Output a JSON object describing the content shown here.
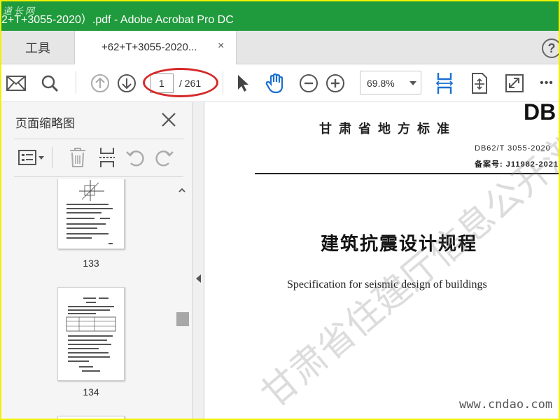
{
  "window": {
    "site_mark": "道长网",
    "title": "2+T+3055-2020）.pdf - Adobe Acrobat Pro DC"
  },
  "tabs": {
    "tools_label": "工具",
    "doc_tab_label": "+62+T+3055-2020...",
    "close_glyph": "×",
    "help_glyph": "?"
  },
  "toolbar": {
    "icons": [
      "mail-icon",
      "search-icon",
      "prev-page-icon",
      "next-page-icon",
      "select-arrow-icon",
      "hand-tool-icon",
      "zoom-out-icon",
      "zoom-in-icon",
      "fit-page-icon",
      "scroll-mode-icon",
      "full-screen-icon",
      "more-icon"
    ],
    "page_current": "1",
    "page_total": "/ 261",
    "zoom": "69.8%",
    "more_glyph": "•••",
    "accent_color": "#1a6fd1",
    "highlight_color": "#d62a2a"
  },
  "thumbnails_panel": {
    "title": "页面缩略图",
    "close_glyph": "×",
    "tools": [
      "thumbnail-options-icon",
      "delete-page-icon",
      "insert-pages-icon",
      "rotate-left-icon",
      "rotate-right-icon"
    ],
    "pages": [
      {
        "number": "133"
      },
      {
        "number": "134"
      }
    ]
  },
  "document": {
    "logo": "DB",
    "standard_org": "甘肃省地方标准",
    "std_code": "DB62/T 3055-2020",
    "record_no": "备案号: J11982-2021",
    "title_cn": "建筑抗震设计规程",
    "title_en": "Specification for seismic design of buildings",
    "watermark": "甘肃省住建厅信息公开浏览专用",
    "site_url": "www.cndao.com"
  }
}
